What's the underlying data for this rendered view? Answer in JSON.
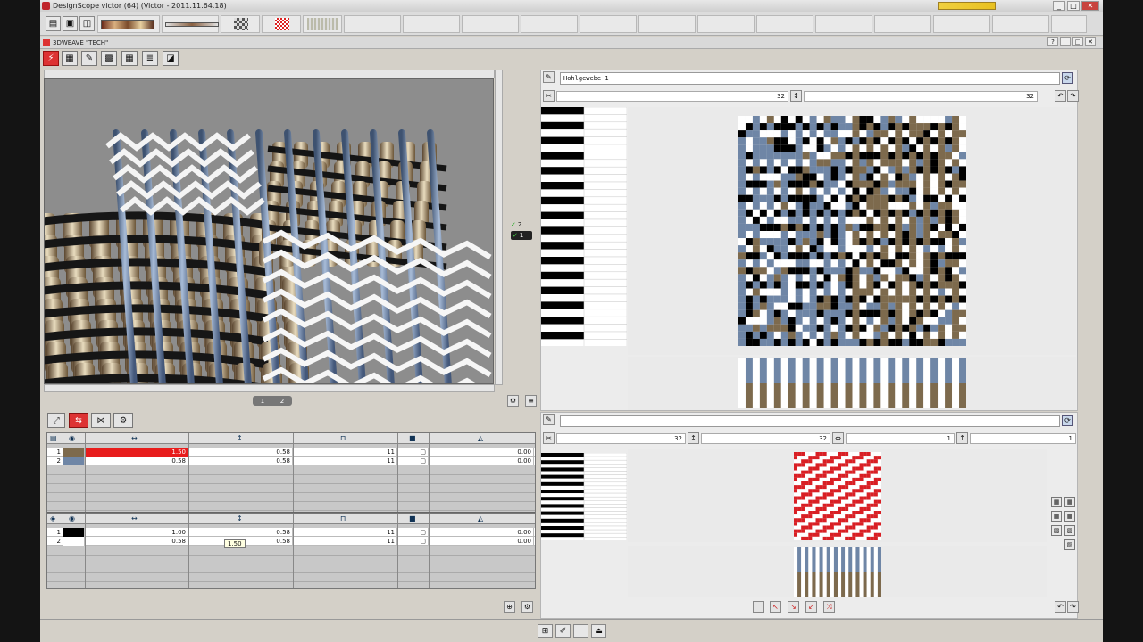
{
  "window": {
    "title": "DesignScope victor (64) (Victor - 2011.11.64.18)",
    "controls": [
      "_",
      "□",
      "✕"
    ]
  },
  "toolbar": {
    "buttons": [
      "open-icon",
      "save-icon",
      "weave-icon"
    ]
  },
  "subwindow": {
    "title": "3DWEAVE \"TECH\"",
    "controls": [
      "?",
      "_",
      "□",
      "✕"
    ]
  },
  "tools": [
    "3dweave-icon",
    "pattern-icon",
    "pen-icon",
    "grid-icon",
    "grid2-icon",
    "layers-icon",
    "blend-icon"
  ],
  "view3d": {
    "layer_counters": [
      {
        "label": "2",
        "checked": true
      },
      {
        "label": "1",
        "checked": true
      }
    ],
    "status_pill": [
      "1",
      "2"
    ]
  },
  "design_top": {
    "name": "Hohlgewebe 1",
    "warp_count": "32",
    "weft_count": "32"
  },
  "design_bottom": {
    "name": "",
    "fields": [
      "32",
      "32",
      "1",
      "1"
    ]
  },
  "warp_table": {
    "rows": [
      {
        "index": "1",
        "color": "#7d6a4d",
        "width": "1.50",
        "spacing": "0.58",
        "count": "11",
        "angle": "0.00",
        "selected": true
      },
      {
        "index": "2",
        "color": "#6f86a6",
        "width": "0.58",
        "spacing": "0.58",
        "count": "11",
        "angle": "0.00",
        "selected": false
      }
    ]
  },
  "weft_table": {
    "rows": [
      {
        "index": "1",
        "color": "#000000",
        "width": "1.00",
        "spacing": "0.58",
        "count": "11",
        "angle": "0.00"
      },
      {
        "index": "2",
        "color": "#ffffff",
        "width": "0.58",
        "spacing": "0.58",
        "count": "11",
        "angle": "0.00"
      }
    ],
    "tooltip": "1.50"
  },
  "colors": {
    "accent_red": "#d9262c",
    "warp_tan": "#7d6a4d",
    "warp_blue": "#6f86a6",
    "pattern_red": "#d91f24"
  }
}
